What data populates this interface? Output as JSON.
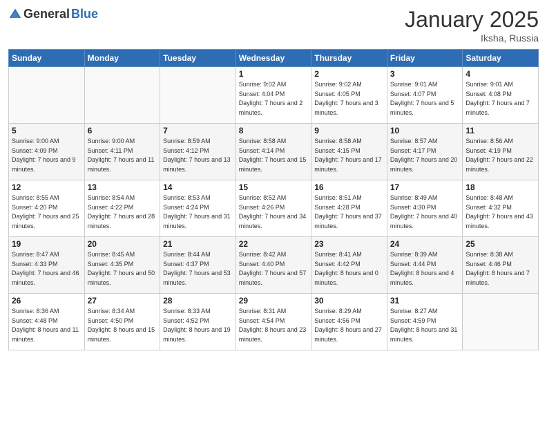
{
  "logo": {
    "general": "General",
    "blue": "Blue"
  },
  "header": {
    "month": "January 2025",
    "location": "Iksha, Russia"
  },
  "weekdays": [
    "Sunday",
    "Monday",
    "Tuesday",
    "Wednesday",
    "Thursday",
    "Friday",
    "Saturday"
  ],
  "weeks": [
    [
      {
        "day": "",
        "sunrise": "",
        "sunset": "",
        "daylight": ""
      },
      {
        "day": "",
        "sunrise": "",
        "sunset": "",
        "daylight": ""
      },
      {
        "day": "",
        "sunrise": "",
        "sunset": "",
        "daylight": ""
      },
      {
        "day": "1",
        "sunrise": "Sunrise: 9:02 AM",
        "sunset": "Sunset: 4:04 PM",
        "daylight": "Daylight: 7 hours and 2 minutes."
      },
      {
        "day": "2",
        "sunrise": "Sunrise: 9:02 AM",
        "sunset": "Sunset: 4:05 PM",
        "daylight": "Daylight: 7 hours and 3 minutes."
      },
      {
        "day": "3",
        "sunrise": "Sunrise: 9:01 AM",
        "sunset": "Sunset: 4:07 PM",
        "daylight": "Daylight: 7 hours and 5 minutes."
      },
      {
        "day": "4",
        "sunrise": "Sunrise: 9:01 AM",
        "sunset": "Sunset: 4:08 PM",
        "daylight": "Daylight: 7 hours and 7 minutes."
      }
    ],
    [
      {
        "day": "5",
        "sunrise": "Sunrise: 9:00 AM",
        "sunset": "Sunset: 4:09 PM",
        "daylight": "Daylight: 7 hours and 9 minutes."
      },
      {
        "day": "6",
        "sunrise": "Sunrise: 9:00 AM",
        "sunset": "Sunset: 4:11 PM",
        "daylight": "Daylight: 7 hours and 11 minutes."
      },
      {
        "day": "7",
        "sunrise": "Sunrise: 8:59 AM",
        "sunset": "Sunset: 4:12 PM",
        "daylight": "Daylight: 7 hours and 13 minutes."
      },
      {
        "day": "8",
        "sunrise": "Sunrise: 8:58 AM",
        "sunset": "Sunset: 4:14 PM",
        "daylight": "Daylight: 7 hours and 15 minutes."
      },
      {
        "day": "9",
        "sunrise": "Sunrise: 8:58 AM",
        "sunset": "Sunset: 4:15 PM",
        "daylight": "Daylight: 7 hours and 17 minutes."
      },
      {
        "day": "10",
        "sunrise": "Sunrise: 8:57 AM",
        "sunset": "Sunset: 4:17 PM",
        "daylight": "Daylight: 7 hours and 20 minutes."
      },
      {
        "day": "11",
        "sunrise": "Sunrise: 8:56 AM",
        "sunset": "Sunset: 4:19 PM",
        "daylight": "Daylight: 7 hours and 22 minutes."
      }
    ],
    [
      {
        "day": "12",
        "sunrise": "Sunrise: 8:55 AM",
        "sunset": "Sunset: 4:20 PM",
        "daylight": "Daylight: 7 hours and 25 minutes."
      },
      {
        "day": "13",
        "sunrise": "Sunrise: 8:54 AM",
        "sunset": "Sunset: 4:22 PM",
        "daylight": "Daylight: 7 hours and 28 minutes."
      },
      {
        "day": "14",
        "sunrise": "Sunrise: 8:53 AM",
        "sunset": "Sunset: 4:24 PM",
        "daylight": "Daylight: 7 hours and 31 minutes."
      },
      {
        "day": "15",
        "sunrise": "Sunrise: 8:52 AM",
        "sunset": "Sunset: 4:26 PM",
        "daylight": "Daylight: 7 hours and 34 minutes."
      },
      {
        "day": "16",
        "sunrise": "Sunrise: 8:51 AM",
        "sunset": "Sunset: 4:28 PM",
        "daylight": "Daylight: 7 hours and 37 minutes."
      },
      {
        "day": "17",
        "sunrise": "Sunrise: 8:49 AM",
        "sunset": "Sunset: 4:30 PM",
        "daylight": "Daylight: 7 hours and 40 minutes."
      },
      {
        "day": "18",
        "sunrise": "Sunrise: 8:48 AM",
        "sunset": "Sunset: 4:32 PM",
        "daylight": "Daylight: 7 hours and 43 minutes."
      }
    ],
    [
      {
        "day": "19",
        "sunrise": "Sunrise: 8:47 AM",
        "sunset": "Sunset: 4:33 PM",
        "daylight": "Daylight: 7 hours and 46 minutes."
      },
      {
        "day": "20",
        "sunrise": "Sunrise: 8:45 AM",
        "sunset": "Sunset: 4:35 PM",
        "daylight": "Daylight: 7 hours and 50 minutes."
      },
      {
        "day": "21",
        "sunrise": "Sunrise: 8:44 AM",
        "sunset": "Sunset: 4:37 PM",
        "daylight": "Daylight: 7 hours and 53 minutes."
      },
      {
        "day": "22",
        "sunrise": "Sunrise: 8:42 AM",
        "sunset": "Sunset: 4:40 PM",
        "daylight": "Daylight: 7 hours and 57 minutes."
      },
      {
        "day": "23",
        "sunrise": "Sunrise: 8:41 AM",
        "sunset": "Sunset: 4:42 PM",
        "daylight": "Daylight: 8 hours and 0 minutes."
      },
      {
        "day": "24",
        "sunrise": "Sunrise: 8:39 AM",
        "sunset": "Sunset: 4:44 PM",
        "daylight": "Daylight: 8 hours and 4 minutes."
      },
      {
        "day": "25",
        "sunrise": "Sunrise: 8:38 AM",
        "sunset": "Sunset: 4:46 PM",
        "daylight": "Daylight: 8 hours and 7 minutes."
      }
    ],
    [
      {
        "day": "26",
        "sunrise": "Sunrise: 8:36 AM",
        "sunset": "Sunset: 4:48 PM",
        "daylight": "Daylight: 8 hours and 11 minutes."
      },
      {
        "day": "27",
        "sunrise": "Sunrise: 8:34 AM",
        "sunset": "Sunset: 4:50 PM",
        "daylight": "Daylight: 8 hours and 15 minutes."
      },
      {
        "day": "28",
        "sunrise": "Sunrise: 8:33 AM",
        "sunset": "Sunset: 4:52 PM",
        "daylight": "Daylight: 8 hours and 19 minutes."
      },
      {
        "day": "29",
        "sunrise": "Sunrise: 8:31 AM",
        "sunset": "Sunset: 4:54 PM",
        "daylight": "Daylight: 8 hours and 23 minutes."
      },
      {
        "day": "30",
        "sunrise": "Sunrise: 8:29 AM",
        "sunset": "Sunset: 4:56 PM",
        "daylight": "Daylight: 8 hours and 27 minutes."
      },
      {
        "day": "31",
        "sunrise": "Sunrise: 8:27 AM",
        "sunset": "Sunset: 4:59 PM",
        "daylight": "Daylight: 8 hours and 31 minutes."
      },
      {
        "day": "",
        "sunrise": "",
        "sunset": "",
        "daylight": ""
      }
    ]
  ]
}
